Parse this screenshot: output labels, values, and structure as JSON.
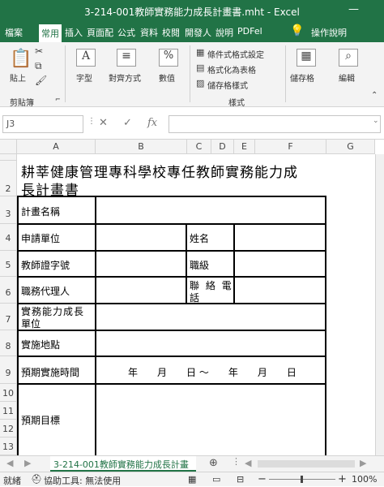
{
  "window": {
    "title": "3-214-001教師實務能力成長計畫書.mht - Excel"
  },
  "tabs": [
    "檔案",
    "常用",
    "插入",
    "頁面配",
    "公式",
    "資料",
    "校閱",
    "開發人",
    "說明",
    "PDFel"
  ],
  "tell_me": "操作說明",
  "ribbon": {
    "paste": "貼上",
    "clipboard": "剪貼簿",
    "font": "字型",
    "align": "對齊方式",
    "number": "數值",
    "cond_format": "條件式格式設定",
    "format_table": "格式化為表格",
    "cell_styles": "儲存格樣式",
    "styles": "樣式",
    "cells": "儲存格",
    "edit": "編輯"
  },
  "formula_bar": {
    "name_box": "J3",
    "fx": "fx",
    "value": ""
  },
  "columns": [
    "A",
    "B",
    "C",
    "D",
    "E",
    "F",
    "G"
  ],
  "rows": [
    "1",
    "2",
    "3",
    "4",
    "5",
    "6",
    "7",
    "8",
    "9",
    "10",
    "11",
    "12",
    "13"
  ],
  "sheet": {
    "title_line1": "耕莘健康管理專科學校專任教師實務能力成",
    "title_line2": "長計畫書",
    "plan_name": "計畫名稱",
    "applicant_unit": "申請單位",
    "name": "姓名",
    "cert_no": "教師證字號",
    "rank": "職級",
    "deputy": "職務代理人",
    "phone1": "聯 絡 電",
    "phone2": "話",
    "practice1": "實務能力成長",
    "practice2": "單位",
    "location": "實施地點",
    "period": "預期實施時間",
    "date_text": "年　　月　　日 〜　　年　　月　　日",
    "goal": "預期目標"
  },
  "sheet_tab": "3-214-001教師實務能力成長計畫",
  "status": {
    "ready": "就緒",
    "accessibility": "協助工具: 無法使用",
    "zoom": "100%"
  }
}
